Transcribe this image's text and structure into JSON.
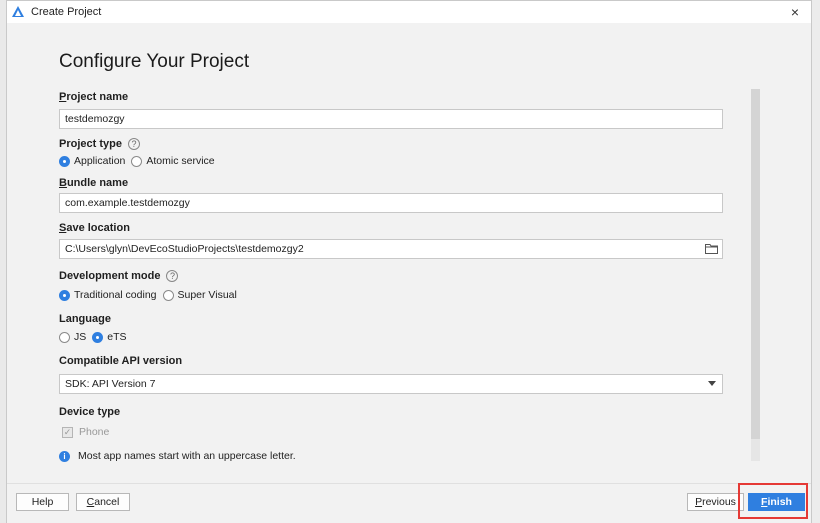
{
  "window": {
    "title": "Create Project",
    "close_label": "×"
  },
  "page": {
    "heading": "Configure Your Project"
  },
  "form": {
    "project_name": {
      "label_first": "P",
      "label_rest": "roject name",
      "value": "testdemozgy"
    },
    "project_type": {
      "label": "Project type",
      "help": "?",
      "options": [
        {
          "label": "Application",
          "checked": true
        },
        {
          "label": "Atomic service",
          "checked": false
        }
      ]
    },
    "bundle_name": {
      "label_first": "B",
      "label_rest": "undle name",
      "value": "com.example.testdemozgy"
    },
    "save_location": {
      "label_first": "S",
      "label_rest": "ave location",
      "value": "C:\\Users\\glyn\\DevEcoStudioProjects\\testdemozgy2"
    },
    "development_mode": {
      "label": "Development mode",
      "help": "?",
      "options": [
        {
          "label": "Traditional coding",
          "checked": true
        },
        {
          "label": "Super Visual",
          "checked": false
        }
      ]
    },
    "language": {
      "label": "Language",
      "options": [
        {
          "label": "JS",
          "checked": false
        },
        {
          "label": "eTS",
          "checked": true
        }
      ]
    },
    "api_version": {
      "label": "Compatible API version",
      "value": "SDK: API Version 7"
    },
    "device_type": {
      "label": "Device type",
      "options": [
        {
          "label": "Phone",
          "checked": true,
          "disabled": true
        }
      ]
    },
    "info": {
      "icon": "i",
      "text": "Most app names start with an uppercase letter."
    }
  },
  "footer": {
    "help_label": "Help",
    "cancel_first": "C",
    "cancel_rest": "ancel",
    "previous_first": "P",
    "previous_rest": "revious",
    "finish_first": "F",
    "finish_rest": "inish"
  },
  "colors": {
    "accent": "#2f7fe0",
    "highlight": "#e53935"
  }
}
